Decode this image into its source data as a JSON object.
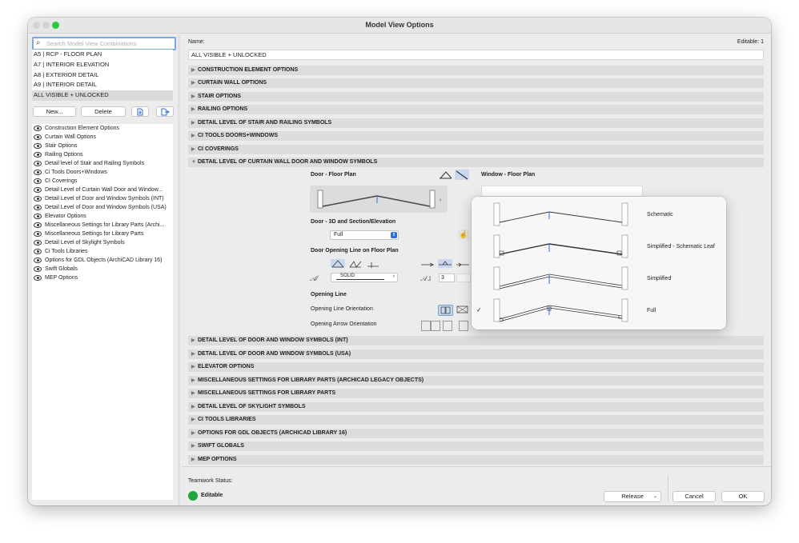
{
  "window": {
    "title": "Model View Options"
  },
  "search": {
    "placeholder": "Search Model View Combinations"
  },
  "combinations": [
    "A5 | RCP - FLOOR PLAN",
    "A7 | INTERIOR ELEVATION",
    "A8 | EXTERIOR DETAIL",
    "A9 | INTERIOR DETAIL",
    "ALL VISIBLE + UNLOCKED"
  ],
  "left_buttons": {
    "new": "New...",
    "delete": "Delete"
  },
  "visibility_items": [
    "Construction Element Options",
    "Curtain Wall Options",
    "Stair Options",
    "Railing Options",
    "Detail level of Stair and Railing Symbols",
    "Ci Tools Doors+Windows",
    "CI Coverings",
    "Detail Level of Curtain Wall Door and Window...",
    "Detail Level of Door and Window Symbols (INT)",
    "Detail Level of Door and Window Symbols (USA)",
    "Elevator Options",
    "Miscellaneous Settings for Library Parts (Archi...",
    "Miscellaneous Settings for Library Parts",
    "Detail Level of Skylight Symbols",
    "Ci Tools Libraries",
    "Options for GDL Objects (ArchiCAD Library 16)",
    "Swift Globals",
    "MEP Options"
  ],
  "name_section": {
    "label": "Name:",
    "value": "ALL VISIBLE + UNLOCKED",
    "editable": "Editable: 1"
  },
  "sections_top": [
    "CONSTRUCTION ELEMENT OPTIONS",
    "CURTAIN WALL OPTIONS",
    "STAIR OPTIONS",
    "RAILING OPTIONS",
    "DETAIL LEVEL OF STAIR AND RAILING SYMBOLS",
    "CI TOOLS DOORS+WINDOWS",
    "CI COVERINGS"
  ],
  "expanded_section": "DETAIL LEVEL OF CURTAIN WALL DOOR AND WINDOW SYMBOLS",
  "sections_bottom": [
    "DETAIL LEVEL OF DOOR AND WINDOW SYMBOLS (INT)",
    "DETAIL LEVEL OF DOOR AND WINDOW SYMBOLS (USA)",
    "ELEVATOR OPTIONS",
    "MISCELLANEOUS SETTINGS FOR LIBRARY PARTS (ARCHICAD LEGACY OBJECTS)",
    "MISCELLANEOUS SETTINGS FOR LIBRARY PARTS",
    "DETAIL LEVEL OF SKYLIGHT SYMBOLS",
    "CI TOOLS LIBRARIES",
    "OPTIONS FOR GDL OBJECTS (ARCHICAD LIBRARY 16)",
    "SWIFT GLOBALS",
    "MEP OPTIONS"
  ],
  "detail": {
    "door_floor_plan": "Door - Floor Plan",
    "window_floor_plan": "Window - Floor Plan",
    "door_3d": "Door - 3D and Section/Elevation",
    "door_3d_value": "Full",
    "door_opening_line": "Door Opening Line on Floor Plan",
    "line_type": "SOLID",
    "line_number": "3",
    "opening_line": "Opening Line",
    "opening_line_orientation": "Opening Line Orientation",
    "opening_arrow_orientation": "Opening Arrow Orientation"
  },
  "popup": {
    "options": [
      "Schematic",
      "Simplified - Schematic Leaf",
      "Simplified",
      "Full"
    ],
    "selected": "Full",
    "check": "✓"
  },
  "footer": {
    "teamwork_label": "Teamwork Status:",
    "status": "Editable",
    "status_color": "#1fa83a",
    "release": "Release",
    "cancel": "Cancel",
    "ok": "OK"
  }
}
